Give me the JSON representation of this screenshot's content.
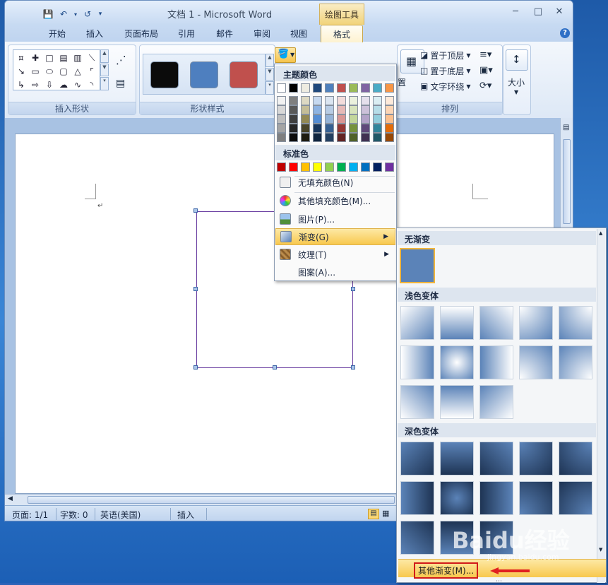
{
  "window": {
    "title": "文档 1 - Microsoft Word",
    "context_tab": "绘图工具",
    "controls": [
      "─",
      "□",
      "✕"
    ]
  },
  "tabs": [
    "开始",
    "插入",
    "页面布局",
    "引用",
    "邮件",
    "审阅",
    "视图",
    "格式"
  ],
  "ribbon": {
    "group_insert_shapes": "插入形状",
    "group_shape_styles": "形状样式",
    "group_arrange": "排列",
    "bring_front": "置于顶层",
    "send_back": "置于底层",
    "text_wrap": "文字环绕",
    "position_partial": "置",
    "size_label": "大小"
  },
  "shape_style_colors": [
    "#0b0b0b",
    "#4e7fbf",
    "#c0504d"
  ],
  "fill_menu": {
    "theme_colors_header": "主题颜色",
    "standard_colors_header": "标准色",
    "theme_top_row": [
      "#ffffff",
      "#000000",
      "#eeece1",
      "#1f497d",
      "#4f81bd",
      "#c0504d",
      "#9bbb59",
      "#8064a2",
      "#4bacc6",
      "#f79646"
    ],
    "theme_shades": [
      [
        "#f2f2f2",
        "#7f7f7f",
        "#ddd9c3",
        "#c6d9f0",
        "#dbe5f1",
        "#f2dcdb",
        "#ebf1dd",
        "#e5e0ec",
        "#dbeef3",
        "#fdeada"
      ],
      [
        "#d8d8d8",
        "#595959",
        "#c4bd97",
        "#8db3e2",
        "#b8cce4",
        "#e5b9b7",
        "#d7e3bc",
        "#ccc1d9",
        "#b7dde8",
        "#fbd5b5"
      ],
      [
        "#bfbfbf",
        "#3f3f3f",
        "#938953",
        "#548dd4",
        "#95b3d7",
        "#d99694",
        "#c3d69b",
        "#b2a2c7",
        "#92cddc",
        "#fac08f"
      ],
      [
        "#a5a5a5",
        "#262626",
        "#494429",
        "#17365d",
        "#366092",
        "#953734",
        "#76923c",
        "#5f497a",
        "#31859b",
        "#e36c09"
      ],
      [
        "#7f7f7f",
        "#0c0c0c",
        "#1d1b10",
        "#0f243e",
        "#244061",
        "#632423",
        "#4f6128",
        "#3f3151",
        "#205867",
        "#974806"
      ]
    ],
    "standard_colors": [
      "#c00000",
      "#ff0000",
      "#ffc000",
      "#ffff00",
      "#92d050",
      "#00b050",
      "#00b0f0",
      "#0070c0",
      "#002060",
      "#7030a0"
    ],
    "items": {
      "no_fill": "无填充颜色(N)",
      "more_colors": "其他填充颜色(M)...",
      "picture": "图片(P)...",
      "gradient": "渐变(G)",
      "texture": "纹理(T)",
      "pattern": "图案(A)..."
    }
  },
  "gradient_panel": {
    "no_gradient_header": "无渐变",
    "light_header": "浅色变体",
    "dark_header": "深色变体",
    "more_gradients": "其他渐变(M)...",
    "base_color": "#5b83b8",
    "light_count": 13,
    "dark_count": 13
  },
  "status_bar": {
    "page": "页面: 1/1",
    "words": "字数: 0",
    "language": "英语(美国)",
    "mode": "插入"
  },
  "watermark": {
    "brand": "Baidu经验",
    "url": "jingyan.baidu.com"
  }
}
